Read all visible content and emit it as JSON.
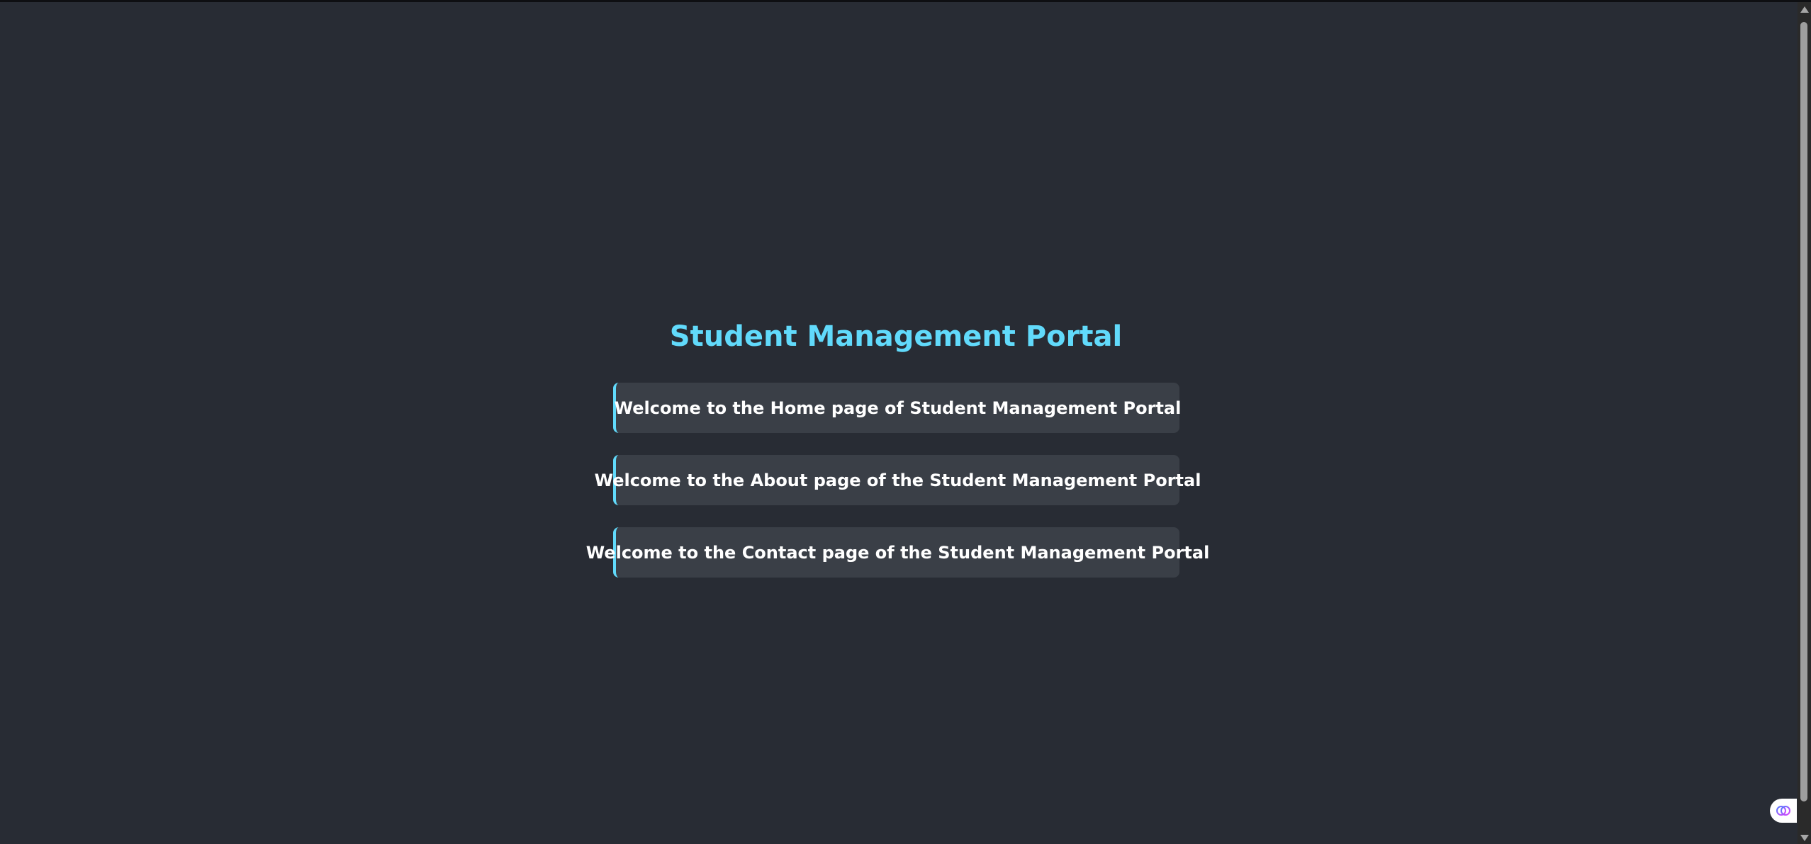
{
  "page": {
    "title": "Student Management Portal"
  },
  "cards": [
    {
      "text": "Welcome to the Home page of Student Management Portal"
    },
    {
      "text": "Welcome to the About page of the Student Management Portal"
    },
    {
      "text": "Welcome to the Contact page of the Student Management Portal"
    }
  ],
  "colors": {
    "background": "#282c34",
    "accent": "#61dafb",
    "card_background": "#3a3f47",
    "text": "#ffffff"
  },
  "icons": {
    "floating_badge": "brain-icon"
  }
}
